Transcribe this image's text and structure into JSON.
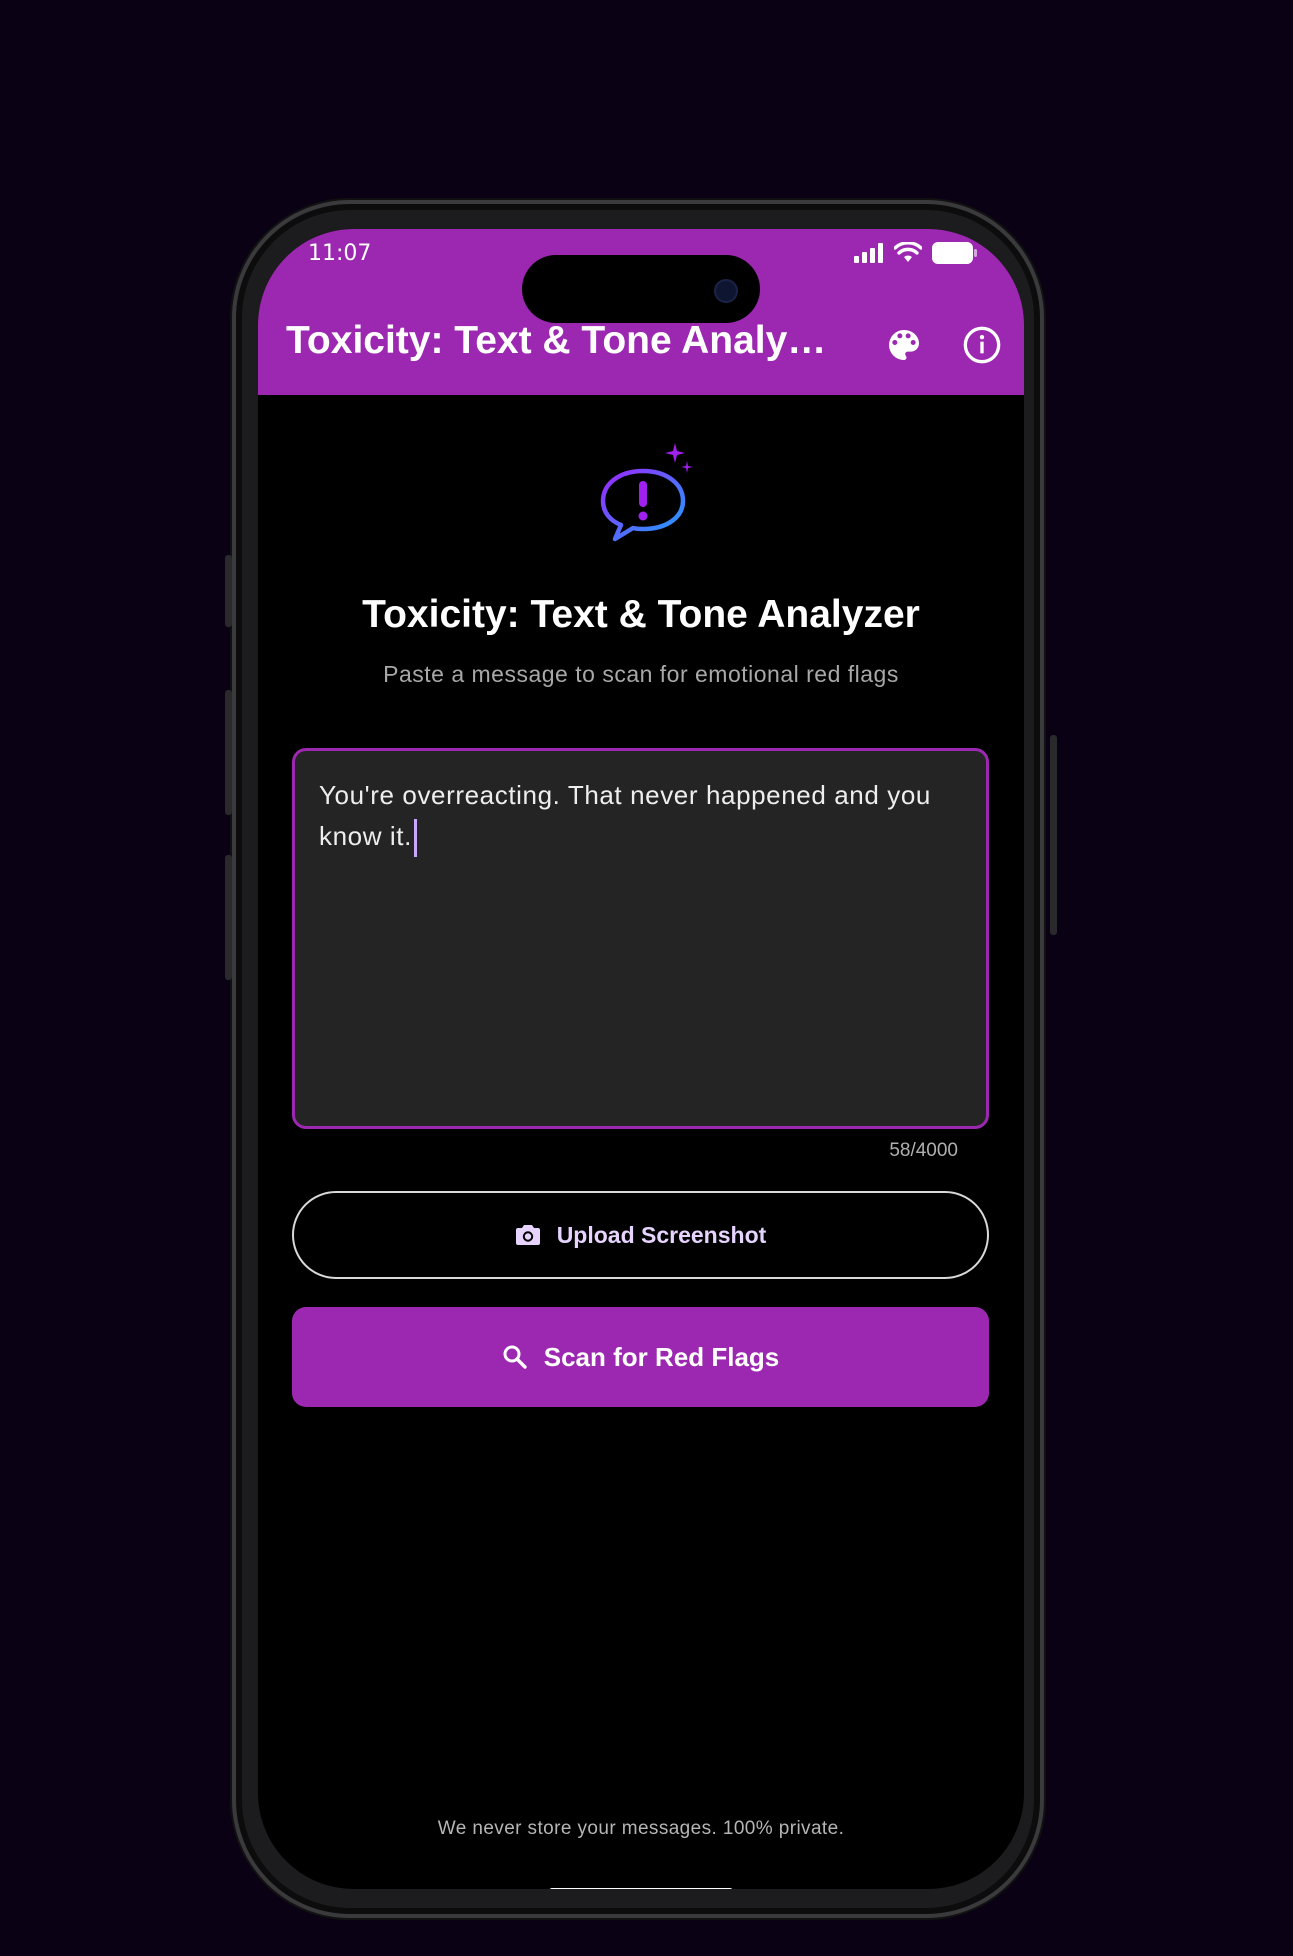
{
  "status_bar": {
    "time": "11:07"
  },
  "app_bar": {
    "title": "Toxicity: Text & Tone Analyz...",
    "icons": [
      "palette-icon",
      "info-icon"
    ],
    "color": "#9c27b0"
  },
  "hero": {
    "logo_icon": "speech-bubble-exclamation-icon",
    "title": "Toxicity: Text & Tone Analyzer",
    "subtitle": "Paste a message to scan for emotional red flags"
  },
  "message_input": {
    "value": "You're overreacting.  That never happened and you know it.",
    "counter": "58/4000"
  },
  "buttons": {
    "upload_label": "Upload Screenshot",
    "upload_icon": "camera-icon",
    "scan_label": "Scan for Red Flags",
    "scan_icon": "search-icon"
  },
  "footer": {
    "privacy_note": "We never store your messages. 100% private."
  }
}
